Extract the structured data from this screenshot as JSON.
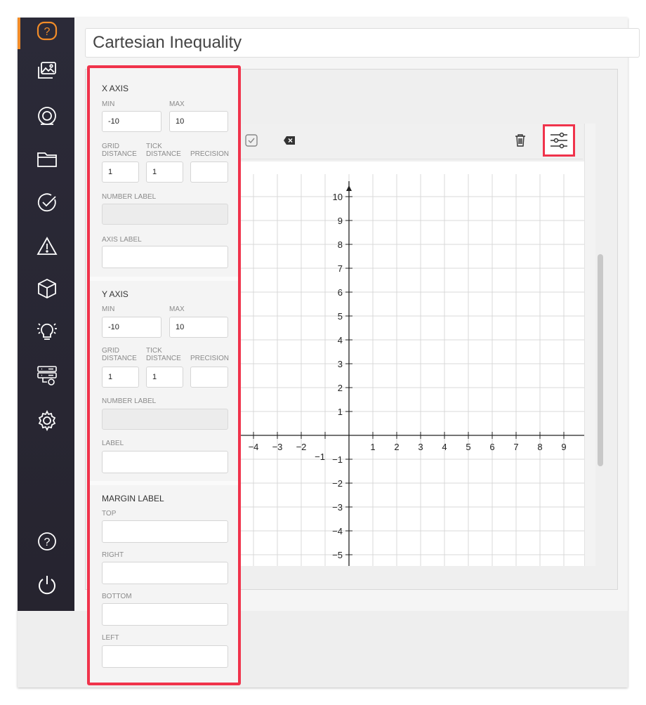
{
  "title": "Cartesian Inequality",
  "colors": {
    "sidebar": "#2b2a38",
    "accent": "#f28c28",
    "highlight": "#f0334b"
  },
  "sidebar": {
    "items": [
      {
        "icon": "help-question-icon",
        "active": true
      },
      {
        "icon": "images-icon"
      },
      {
        "icon": "target-icon"
      },
      {
        "icon": "folder-icon"
      },
      {
        "icon": "check-circle-icon"
      },
      {
        "icon": "warning-triangle-icon"
      },
      {
        "icon": "cube-icon"
      },
      {
        "icon": "lightbulb-icon"
      },
      {
        "icon": "server-settings-icon"
      },
      {
        "icon": "settings-gear-icon"
      }
    ],
    "bottom": [
      {
        "icon": "help-circle-icon"
      },
      {
        "icon": "power-icon"
      }
    ]
  },
  "toolbar": {
    "icons": [
      "check-icon",
      "delete-tag-icon",
      "trash-icon",
      "sliders-settings-icon"
    ]
  },
  "x_axis": {
    "title": "X AXIS",
    "min_label": "MIN",
    "min": "-10",
    "max_label": "MAX",
    "max": "10",
    "grid_label_1": "GRID",
    "grid_label_2": "DISTANCE",
    "grid": "1",
    "tick_label_1": "TICK",
    "tick_label_2": "DISTANCE",
    "tick": "1",
    "precision_label": "PRECISION",
    "precision": "",
    "number_label": "NUMBER LABEL",
    "axis_label": "AXIS LABEL"
  },
  "y_axis": {
    "title": "Y AXIS",
    "min_label": "MIN",
    "min": "-10",
    "max_label": "MAX",
    "max": "10",
    "grid_label_1": "GRID",
    "grid_label_2": "DISTANCE",
    "grid": "1",
    "tick_label_1": "TICK",
    "tick_label_2": "DISTANCE",
    "tick": "1",
    "precision_label": "PRECISION",
    "precision": "",
    "number_label": "NUMBER LABEL",
    "label": "LABEL"
  },
  "margin": {
    "title": "MARGIN LABEL",
    "top": "TOP",
    "right": "RIGHT",
    "bottom": "BOTTOM",
    "left": "LEFT"
  },
  "graph": {
    "x_ticks": [
      "−4",
      "−3",
      "−2",
      "−1",
      "1",
      "2",
      "3",
      "4",
      "5",
      "6",
      "7",
      "8",
      "9"
    ],
    "x_tick_values": [
      -4,
      -3,
      -2,
      -1,
      1,
      2,
      3,
      4,
      5,
      6,
      7,
      8,
      9
    ],
    "y_ticks": [
      "10",
      "9",
      "8",
      "7",
      "6",
      "5",
      "4",
      "3",
      "2",
      "1",
      "−1",
      "−2",
      "−3",
      "−4",
      "−5"
    ],
    "y_tick_values": [
      10,
      9,
      8,
      7,
      6,
      5,
      4,
      3,
      2,
      1,
      -1,
      -2,
      -3,
      -4,
      -5
    ]
  }
}
